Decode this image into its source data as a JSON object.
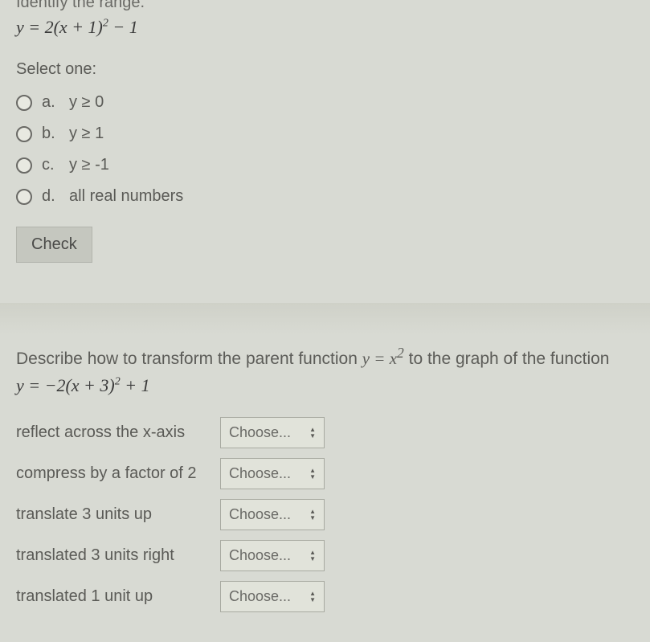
{
  "q1": {
    "heading_cut": "Identify the range.",
    "equation_html": "y = 2(x + 1)<sup>2</sup> − 1",
    "select_one": "Select one:",
    "options": [
      {
        "letter": "a.",
        "text": "y ≥ 0"
      },
      {
        "letter": "b.",
        "text": "y ≥ 1"
      },
      {
        "letter": "c.",
        "text": "y ≥ -1"
      },
      {
        "letter": "d.",
        "text": "all real numbers"
      }
    ],
    "check": "Check"
  },
  "q2": {
    "prompt_prefix": "Describe how to transform the parent function ",
    "parent_fn_html": "y = x<sup>2</sup>",
    "prompt_suffix": " to the graph of the function",
    "equation_html": "y = −2(x + 3)<sup>2</sup> + 1",
    "rows": [
      {
        "label": "reflect across the x-axis",
        "placeholder": "Choose..."
      },
      {
        "label": "compress by a factor of 2",
        "placeholder": "Choose..."
      },
      {
        "label": "translate 3 units up",
        "placeholder": "Choose..."
      },
      {
        "label": "translated 3 units right",
        "placeholder": "Choose..."
      },
      {
        "label": "translated 1 unit up",
        "placeholder": "Choose..."
      }
    ]
  }
}
